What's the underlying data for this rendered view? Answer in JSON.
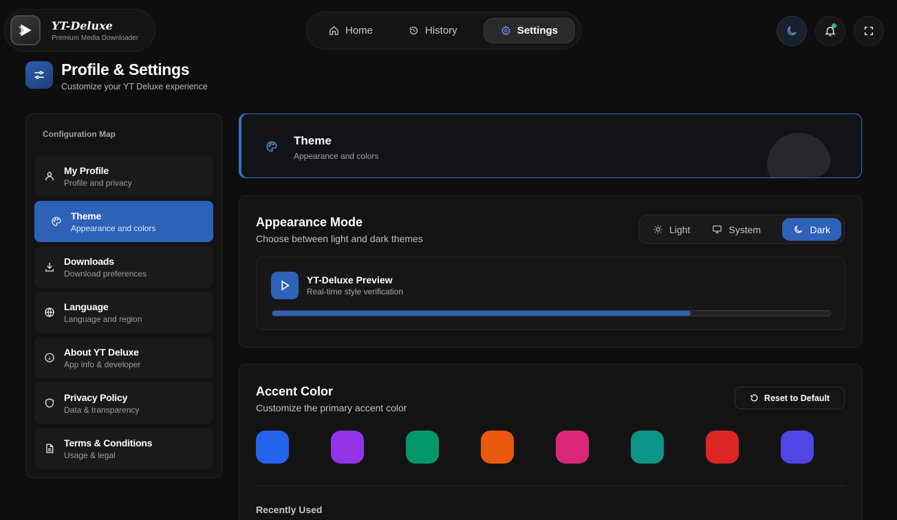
{
  "brand": {
    "title": "YT-Deluxe",
    "subtitle": "Premium Media Downloader"
  },
  "nav": {
    "items": [
      {
        "label": "Home",
        "icon": "home-icon"
      },
      {
        "label": "History",
        "icon": "history-icon"
      },
      {
        "label": "Settings",
        "icon": "gear-icon",
        "active": true
      }
    ]
  },
  "top_icons": [
    "moon-icon",
    "bell-icon",
    "fullscreen-icon"
  ],
  "page": {
    "title": "Profile & Settings",
    "subtitle": "Customize your YT Deluxe experience"
  },
  "sidebar": {
    "heading": "Configuration Map",
    "items": [
      {
        "label": "My Profile",
        "desc": "Profile and privacy",
        "icon": "user-icon"
      },
      {
        "label": "Theme",
        "desc": "Appearance and colors",
        "icon": "palette-icon",
        "active": true
      },
      {
        "label": "Downloads",
        "desc": "Download preferences",
        "icon": "download-icon"
      },
      {
        "label": "Language",
        "desc": "Language and region",
        "icon": "globe-icon"
      },
      {
        "label": "About YT Deluxe",
        "desc": "App info & developer",
        "icon": "info-icon"
      },
      {
        "label": "Privacy Policy",
        "desc": "Data & transparency",
        "icon": "shield-icon"
      },
      {
        "label": "Terms & Conditions",
        "desc": "Usage & legal",
        "icon": "document-icon"
      }
    ]
  },
  "theme_card": {
    "title": "Theme",
    "subtitle": "Appearance and colors"
  },
  "appearance": {
    "title": "Appearance Mode",
    "subtitle": "Choose between light and dark themes",
    "modes": [
      {
        "label": "Light",
        "icon": "sun-icon"
      },
      {
        "label": "System",
        "icon": "monitor-icon"
      },
      {
        "label": "Dark",
        "icon": "moon-icon",
        "active": true
      }
    ],
    "preview": {
      "title": "YT-Deluxe Preview",
      "subtitle": "Real-time style verification",
      "progress": 0.75
    }
  },
  "accent": {
    "title": "Accent Color",
    "subtitle": "Customize the primary accent color",
    "reset_label": "Reset to Default",
    "colors": [
      "#2563eb",
      "#9333ea",
      "#059669",
      "#ea580c",
      "#db2777",
      "#0d9488",
      "#dc2626",
      "#4f46e5"
    ],
    "recent_label": "Recently Used"
  },
  "colors": {
    "accent": "#2e62b8",
    "background": "#0e0e0f",
    "notification": "#22c55e"
  }
}
